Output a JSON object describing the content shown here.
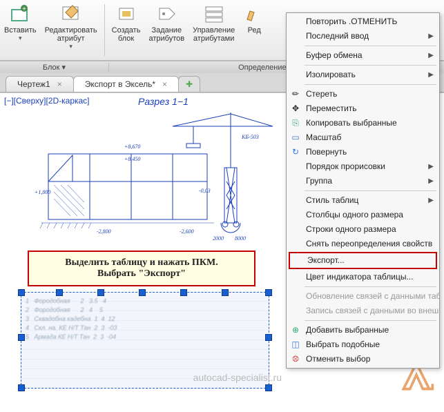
{
  "ribbon": {
    "buttons": {
      "insert": "Вставить",
      "edit_attr": "Редактировать\nатрибут",
      "create_block": "Создать\nблок",
      "set_attrs": "Задание\nатрибутов",
      "manage_attrs": "Управление\nатрибутами",
      "edit_cut": "Ред"
    },
    "panels": {
      "block": "Блок   ▾",
      "block_def": "Определение блока   ▾"
    }
  },
  "tabs": {
    "t1": "Чертеж1",
    "t2": "Экспорт в Эксель*"
  },
  "view": {
    "tag": "[−][Сверху][2D-каркас]",
    "section_title": "Разрез  1−1",
    "crane_label": "КБ-503",
    "elev": {
      "a": "+8,670",
      "b": "+8,450",
      "c": "+1,800",
      "d": "-2,800",
      "e": "-2,600",
      "f": "-0,03"
    },
    "dims": {
      "d1": "2000",
      "d2": "8000"
    }
  },
  "callout": {
    "line1": "Выделить таблицу и нажать ПКМ.",
    "line2": "Выбрать \"Экспорт\""
  },
  "ctx": {
    "repeat": "Повторить .ОТМЕНИТЬ",
    "last_input": "Последний ввод",
    "clipboard": "Буфер обмена",
    "isolate": "Изолировать",
    "erase": "Стереть",
    "move": "Переместить",
    "copysel": "Копировать выбранные",
    "scale": "Масштаб",
    "rotate": "Повернуть",
    "draworder": "Порядок прорисовки",
    "group": "Группа",
    "tablestyle": "Стиль таблиц",
    "colsize": "Столбцы одного размера",
    "rowsize": "Строки одного размера",
    "clearoverride": "Снять переопределения свойств",
    "export": "Экспорт...",
    "indicator": "Цвет индикатора таблицы...",
    "updlinks": "Обновление связей с данными табл",
    "writelinks": "Запись связей с данными во внешн",
    "addsel": "Добавить выбранные",
    "selsim": "Выбрать подобные",
    "deselect": "Отменить выбор"
  },
  "watermark": "autocad-specialist.ru"
}
